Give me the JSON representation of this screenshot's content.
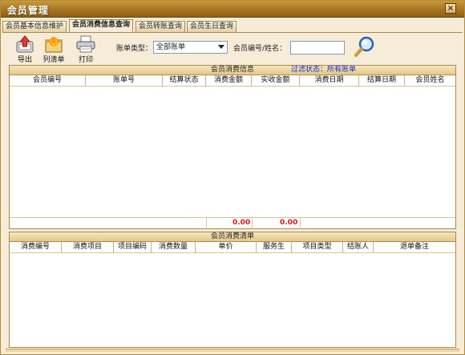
{
  "window": {
    "title": "会员管理",
    "close_label": "×"
  },
  "tabs": [
    {
      "label": "会员基本信息维护"
    },
    {
      "label": "会员消费信息查询"
    },
    {
      "label": "会员转账查询"
    },
    {
      "label": "会员生日查询"
    }
  ],
  "active_tab": 1,
  "toolbar": {
    "export_label": "导出",
    "list_label": "列清单",
    "print_label": "打印"
  },
  "filters": {
    "account_type_label": "账单类型：",
    "account_type_value": "全部账单",
    "member_label": "会员编号/姓名：",
    "member_value": "",
    "member_placeholder": ""
  },
  "consumption_info": {
    "title": "会员消费信息",
    "filter_status": "过滤状态：所有账单",
    "columns": [
      "会员编号",
      "账单号",
      "结算状态",
      "消费金额",
      "实收金额",
      "消费日期",
      "结算日期",
      "会员姓名"
    ],
    "rows": [],
    "total_consumption": "0.00",
    "total_received": "0.00"
  },
  "consumption_list": {
    "title": "会员消费清单",
    "columns": [
      "消费编号",
      "消费项目",
      "项目编码",
      "消费数量",
      "单价",
      "服务生",
      "项目类型",
      "结账人",
      "退单备注"
    ],
    "rows": []
  },
  "colors": {
    "title_bar": "#a77521",
    "accent": "#e2c787",
    "status_blue": "#1a2cc8",
    "total_red": "#e01212"
  }
}
